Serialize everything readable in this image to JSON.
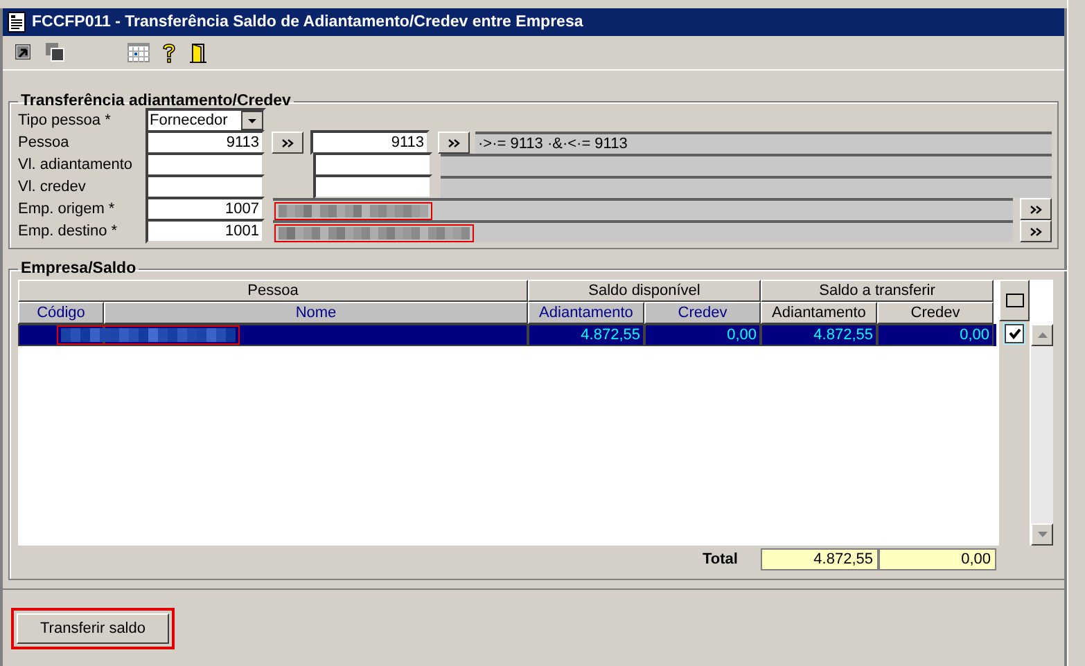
{
  "window": {
    "title": "FCCFP011 - Transferência Saldo de Adiantamento/Credev entre Empresa"
  },
  "transfer_group": {
    "title": "Transferência adiantamento/Credev",
    "tipo_pessoa": {
      "label": "Tipo pessoa *",
      "value": "Fornecedor"
    },
    "pessoa": {
      "label": "Pessoa",
      "from": "9113",
      "to": "9113",
      "filter": "·>·= 9113 ·&·<·= 9113"
    },
    "vl_adiantamento": {
      "label": "Vl. adiantamento"
    },
    "vl_credev": {
      "label": "Vl. credev"
    },
    "emp_origem": {
      "label": "Emp. origem *",
      "value": "1007"
    },
    "emp_destino": {
      "label": "Emp. destino *",
      "value": "1001"
    }
  },
  "saldo_group": {
    "title": "Empresa/Saldo",
    "group_headers": [
      "Pessoa",
      "Saldo disponível",
      "Saldo a transferir"
    ],
    "columns": [
      {
        "label": "Código",
        "highlighted": true
      },
      {
        "label": "Nome",
        "highlighted": true
      },
      {
        "label": "Adiantamento",
        "highlighted": true
      },
      {
        "label": "Credev",
        "highlighted": true
      },
      {
        "label": "Adiantamento",
        "highlighted": false
      },
      {
        "label": "Credev",
        "highlighted": false
      }
    ],
    "select_all": {
      "checked": false
    },
    "rows": [
      {
        "selected": true,
        "checked": true,
        "values": [
          "4.872,55",
          "0,00",
          "4.872,55",
          "0,00"
        ]
      }
    ],
    "total_label": "Total",
    "totals": [
      "4.872,55",
      "0,00"
    ]
  },
  "buttons": [
    "Transferir saldo"
  ]
}
